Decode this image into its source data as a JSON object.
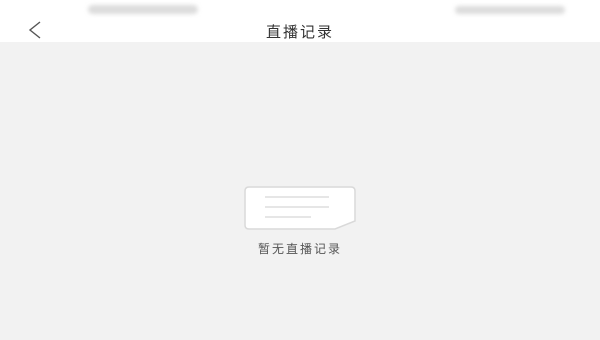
{
  "nav": {
    "title": "直播记录"
  },
  "empty_state": {
    "message": "暂无直播记录"
  }
}
